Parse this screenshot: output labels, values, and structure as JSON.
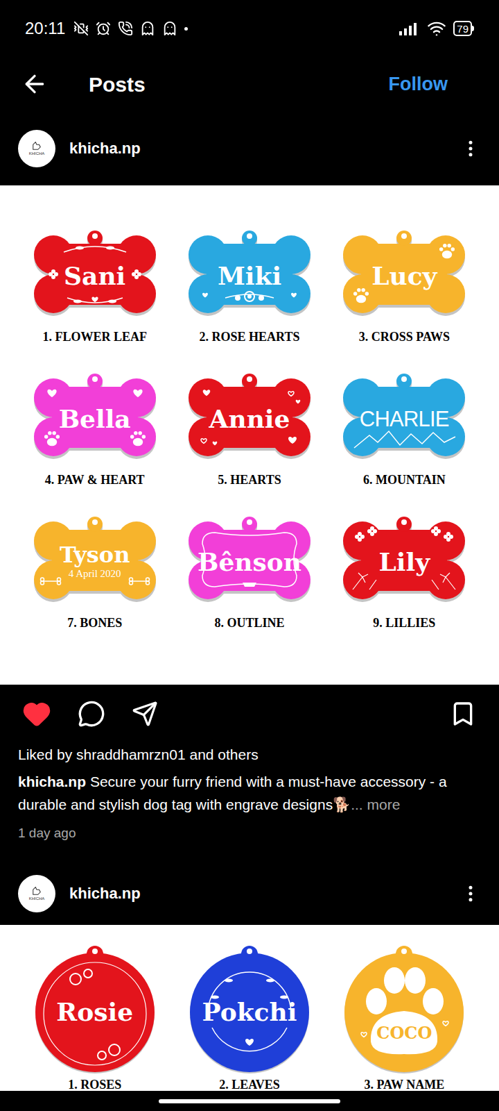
{
  "status_bar": {
    "time": "20:11",
    "battery": "79"
  },
  "header": {
    "title": "Posts",
    "follow": "Follow"
  },
  "posts": [
    {
      "author": "khicha.np",
      "avatar_text": "KHICHA",
      "shape": "bone",
      "tags": [
        {
          "name": "Sani",
          "label": "1. FLOWER LEAF",
          "color": "#e3141c",
          "kind": "flower-leaf"
        },
        {
          "name": "Miki",
          "label": "2. ROSE HEARTS",
          "color": "#29a8e0",
          "kind": "rose-hearts"
        },
        {
          "name": "Lucy",
          "label": "3. CROSS PAWS",
          "color": "#f7b42c",
          "kind": "cross-paws"
        },
        {
          "name": "Bella",
          "label": "4. PAW & HEART",
          "color": "#f23fd8",
          "kind": "paw-heart"
        },
        {
          "name": "Annie",
          "label": "5. HEARTS",
          "color": "#e3141c",
          "kind": "hearts"
        },
        {
          "name": "CHARLIE",
          "label": "6. MOUNTAIN",
          "color": "#29a8e0",
          "kind": "mountain"
        },
        {
          "name": "Tyson",
          "date": "4 April 2020",
          "label": "7. BONES",
          "color": "#f7b42c",
          "kind": "bones"
        },
        {
          "name": "Bênson",
          "label": "8. OUTLINE",
          "color": "#f23fd8",
          "kind": "outline"
        },
        {
          "name": "Lily",
          "label": "9. LILLIES",
          "color": "#e3141c",
          "kind": "lilies"
        }
      ],
      "actions": {
        "liked": true,
        "saved": false
      },
      "liked_by": "Liked by shraddhamrzn01 and others",
      "caption": "Secure your furry friend with a must-have accessory - a durable and stylish dog tag with engrave designs🐕",
      "more": "... more",
      "time": "1 day ago"
    },
    {
      "author": "khicha.np",
      "avatar_text": "KHICHA",
      "shape": "round",
      "tags": [
        {
          "name": "Rosie",
          "label": "1. ROSES",
          "color": "#e3141c",
          "kind": "roses"
        },
        {
          "name": "Pokchi",
          "label": "2. LEAVES",
          "color": "#1f3fd8",
          "kind": "leaves"
        },
        {
          "name": "COCO",
          "label": "3. PAW NAME",
          "color": "#f7b42c",
          "kind": "paw-name"
        }
      ]
    }
  ]
}
